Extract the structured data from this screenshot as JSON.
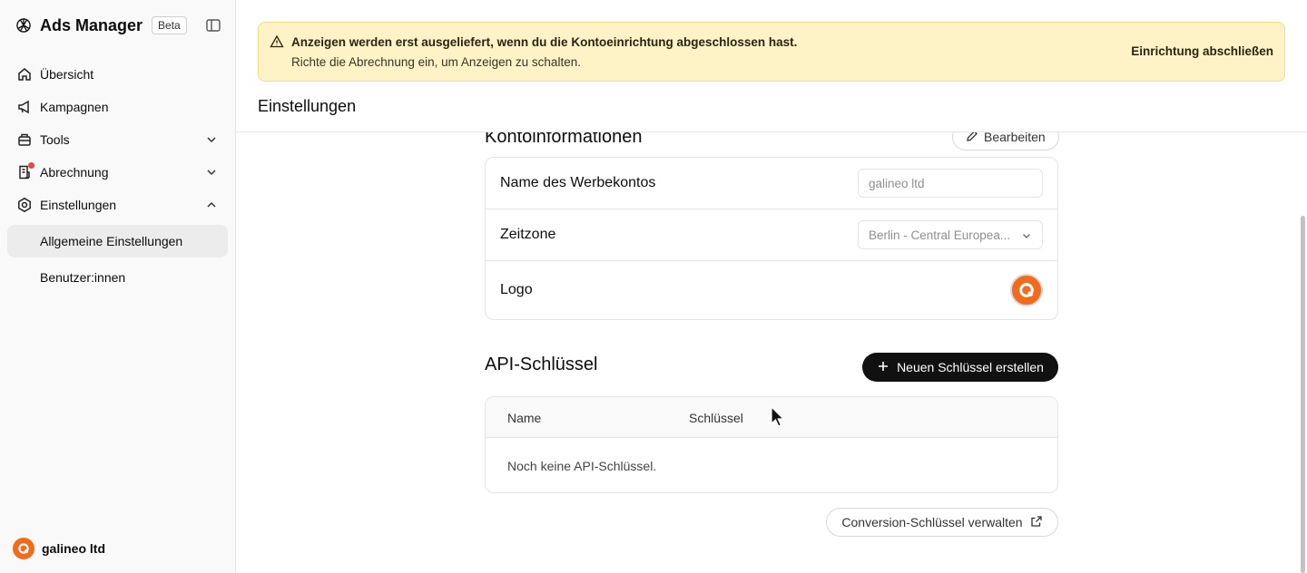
{
  "app": {
    "name": "Ads Manager",
    "badge": "Beta"
  },
  "nav": {
    "overview": "Übersicht",
    "campaigns": "Kampagnen",
    "tools": "Tools",
    "billing": "Abrechnung",
    "settings": "Einstellungen",
    "settings_sub": [
      "Allgemeine Einstellungen",
      "Benutzer:innen"
    ]
  },
  "account": {
    "name": "galineo ltd",
    "brand_color": "#f26b1d"
  },
  "banner": {
    "title": "Anzeigen werden erst ausgeliefert, wenn du die Kontoeinrichtung abgeschlossen hast.",
    "subtitle": "Richte die Abrechnung ein, um Anzeigen zu schalten.",
    "action": "Einrichtung abschließen"
  },
  "page": {
    "title": "Einstellungen"
  },
  "account_info": {
    "title": "Kontoinformationen",
    "edit": "Bearbeiten",
    "name_label": "Name des Werbekontos",
    "name_value": "galineo ltd",
    "timezone_label": "Zeitzone",
    "timezone_value": "Berlin - Central Europea...",
    "logo_label": "Logo"
  },
  "api_keys": {
    "title": "API-Schlüssel",
    "create": "Neuen Schlüssel erstellen",
    "columns": [
      "Name",
      "Schlüssel"
    ],
    "empty": "Noch keine API-Schlüssel.",
    "conversion": "Conversion-Schlüssel verwalten"
  }
}
